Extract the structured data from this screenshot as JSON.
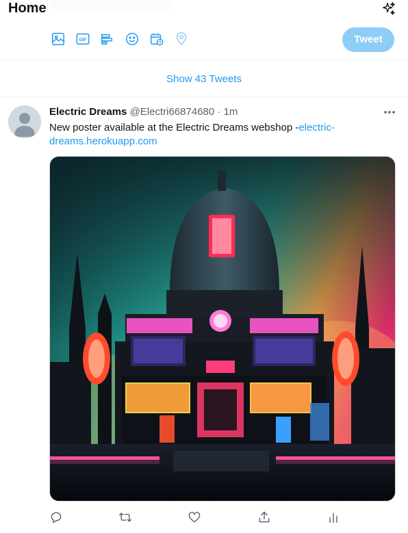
{
  "header": {
    "title": "Home",
    "sparkle_icon": "sparkle-icon"
  },
  "composer": {
    "tools": [
      "image-icon",
      "gif-icon",
      "poll-icon",
      "emoji-icon",
      "schedule-icon",
      "location-icon"
    ],
    "gif_label": "GIF",
    "tweet_button_label": "Tweet"
  },
  "feed": {
    "show_new_label": "Show 43 Tweets"
  },
  "tweet": {
    "author_name": "Electric Dreams",
    "author_handle": "@Electri66874680",
    "separator": "·",
    "time": "1m",
    "text_prefix": "New poster available at the Electric Dreams webshop -",
    "link_text": "electric-dreams.herokuapp.com",
    "more_icon": "more-icon",
    "media_icon": "poster-image",
    "actions": [
      "reply-icon",
      "retweet-icon",
      "like-icon",
      "share-icon",
      "analytics-icon"
    ]
  },
  "colors": {
    "accent": "#1d9bf0",
    "tweet_button_disabled": "#8ecdf8",
    "text_primary": "#0f1419",
    "text_secondary": "#536471",
    "divider": "#eff3f4"
  }
}
